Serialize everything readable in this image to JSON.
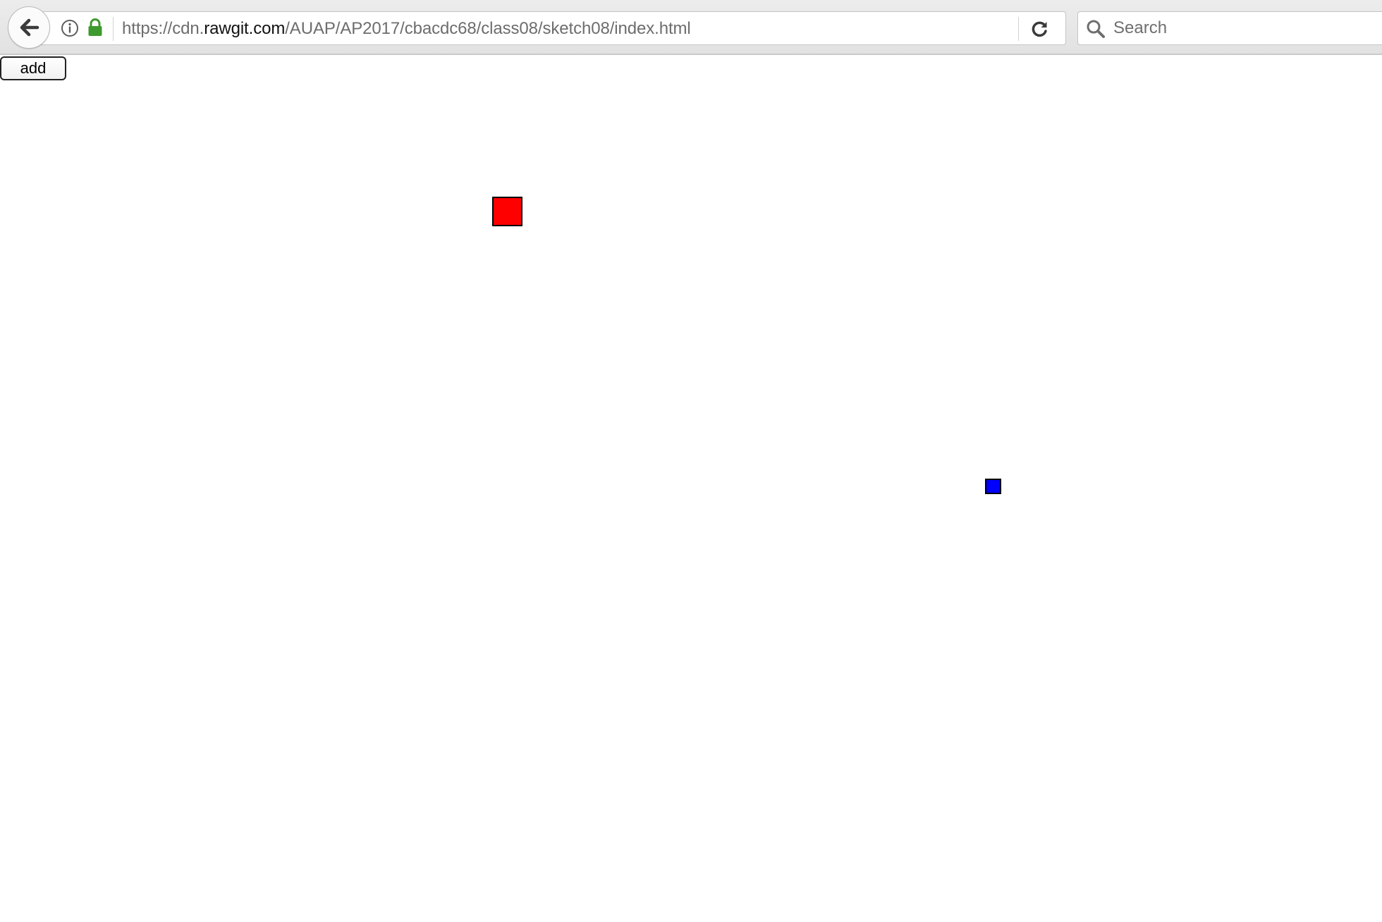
{
  "browser": {
    "url_prefix": "https://cdn.",
    "url_domain": "rawgit.com",
    "url_path": "/AUAP/AP2017/cbacdc68/class08/sketch08/index.html",
    "search_placeholder": "Search"
  },
  "page": {
    "add_button_label": "add",
    "squares": [
      {
        "name": "red-square",
        "color": "#ff0000"
      },
      {
        "name": "blue-square",
        "color": "#0000ff"
      }
    ]
  }
}
